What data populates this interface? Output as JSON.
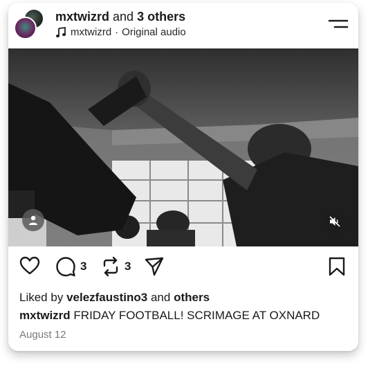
{
  "header": {
    "author": "mxtwizrd",
    "and_text": "and",
    "others_text": "3 others",
    "audio_artist": "mxtwizrd",
    "audio_separator": "·",
    "audio_title": "Original audio",
    "icons": {
      "music": "music-note-icon",
      "menu": "menu-icon"
    }
  },
  "media": {
    "icons": {
      "user_tag": "person-icon",
      "mute": "speaker-muted-icon"
    }
  },
  "actions": {
    "comment_count": "3",
    "repost_count": "3",
    "icons": {
      "like": "heart-icon",
      "comment": "comment-bubble-icon",
      "repost": "repost-icon",
      "share": "send-icon",
      "save": "bookmark-icon"
    }
  },
  "likes": {
    "prefix": "Liked by",
    "user": "velezfaustino3",
    "and_text": "and",
    "others": "others"
  },
  "caption": {
    "user": "mxtwizrd",
    "text": "FRIDAY FOOTBALL! SCRIMAGE AT OXNARD"
  },
  "date": "August 12",
  "colors": {
    "text": "#1a1a1a",
    "muted": "#7a7a7a",
    "card": "#ffffff"
  }
}
